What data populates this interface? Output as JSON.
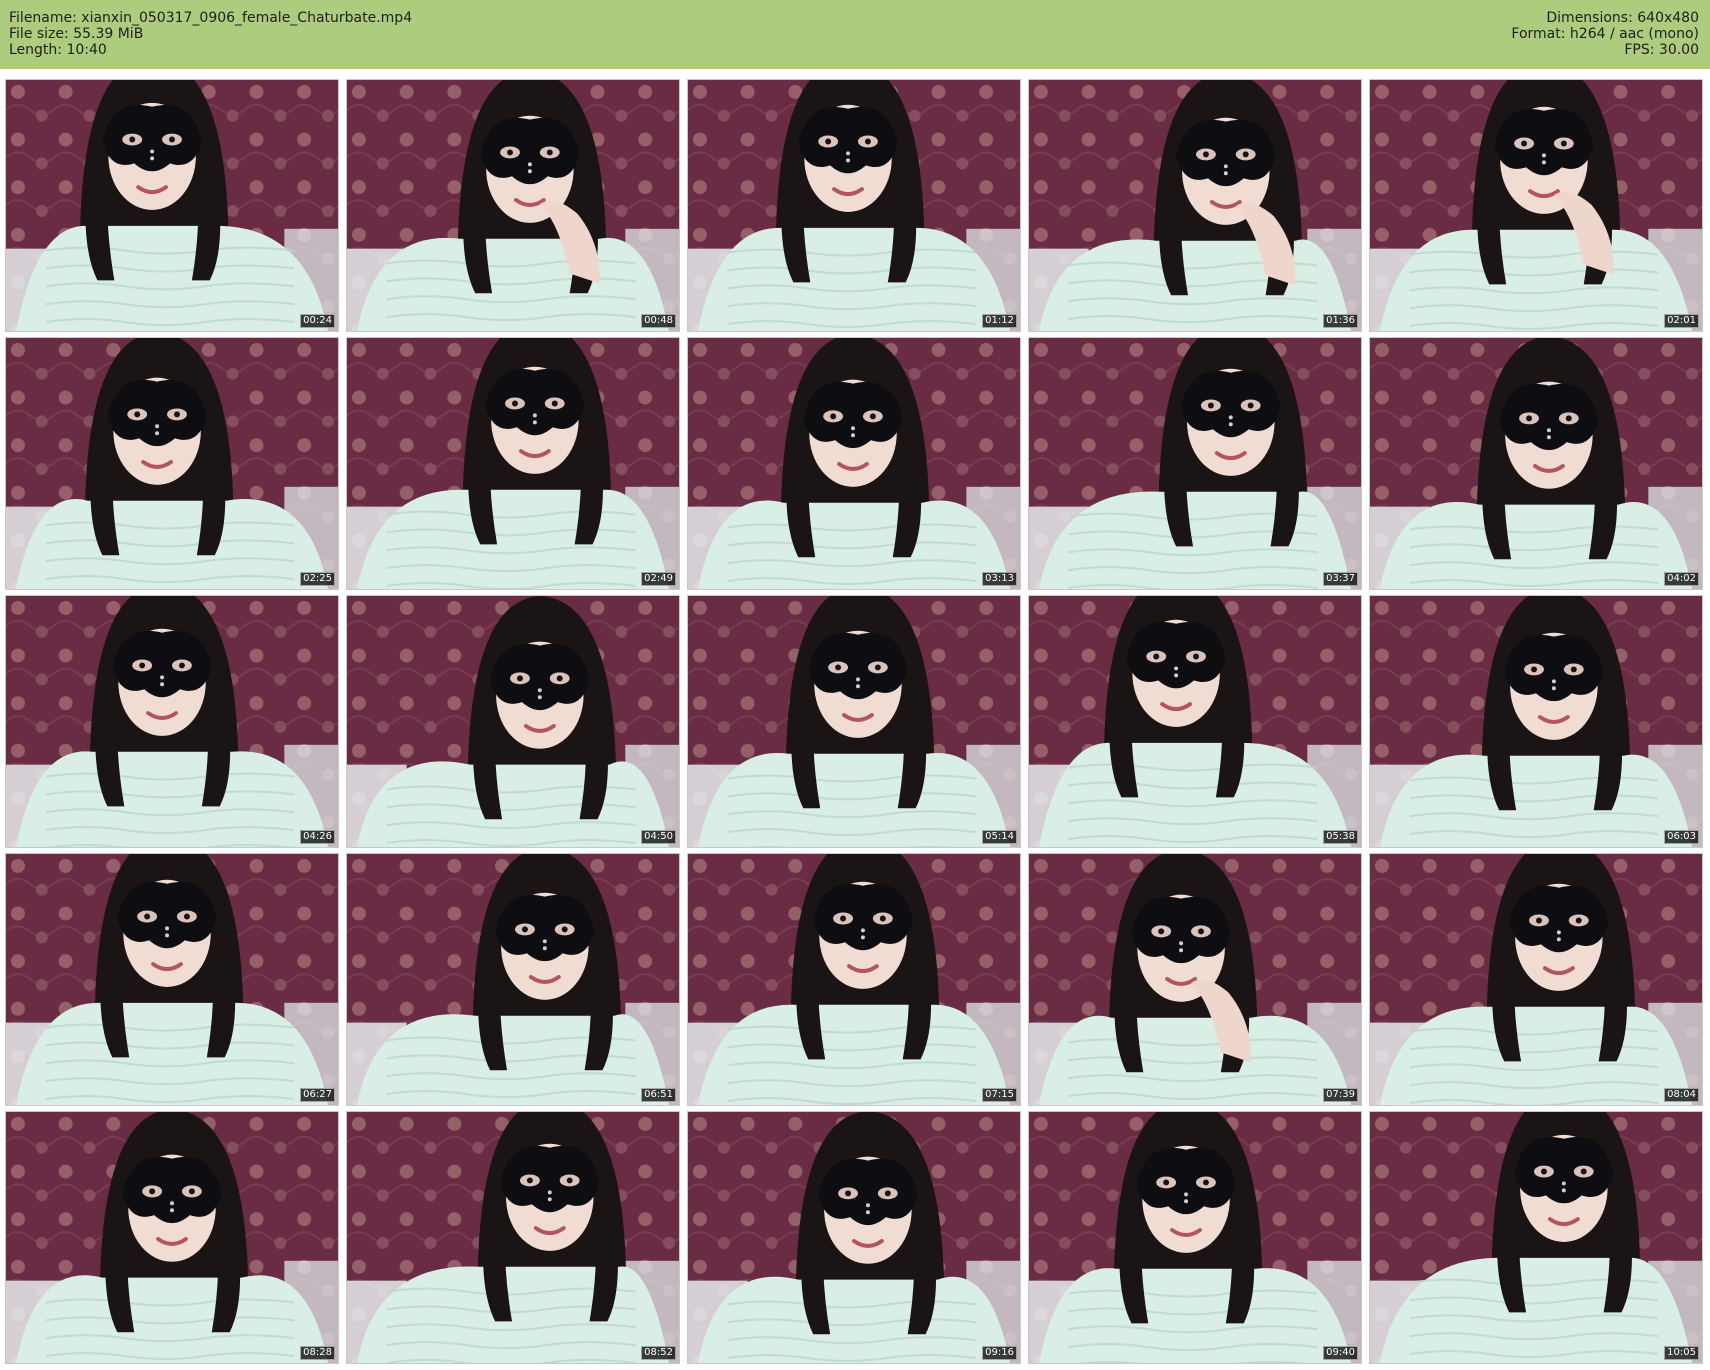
{
  "header": {
    "filename_line": "Filename: xianxin_050317_0906_female_Chaturbate.mp4",
    "filesize_line": "File size: 55.39 MiB",
    "length_line": "Length: 10:40",
    "dimensions_line": "Dimensions: 640x480",
    "format_line": "Format: h264 / aac (mono)",
    "fps_line": "FPS: 30.00",
    "background_color": "#aecc7d"
  },
  "thumbnails": [
    {
      "timestamp": "00:24"
    },
    {
      "timestamp": "00:48"
    },
    {
      "timestamp": "01:12"
    },
    {
      "timestamp": "01:36"
    },
    {
      "timestamp": "02:01"
    },
    {
      "timestamp": "02:25"
    },
    {
      "timestamp": "02:49"
    },
    {
      "timestamp": "03:13"
    },
    {
      "timestamp": "03:37"
    },
    {
      "timestamp": "04:02"
    },
    {
      "timestamp": "04:26"
    },
    {
      "timestamp": "04:50"
    },
    {
      "timestamp": "05:14"
    },
    {
      "timestamp": "05:38"
    },
    {
      "timestamp": "06:03"
    },
    {
      "timestamp": "06:27"
    },
    {
      "timestamp": "06:51"
    },
    {
      "timestamp": "07:15"
    },
    {
      "timestamp": "07:39"
    },
    {
      "timestamp": "08:04"
    },
    {
      "timestamp": "08:28"
    },
    {
      "timestamp": "08:52"
    },
    {
      "timestamp": "09:16"
    },
    {
      "timestamp": "09:40"
    },
    {
      "timestamp": "10:05"
    }
  ],
  "colors": {
    "wallpaper": "#6a2c44",
    "sweater": "#d9eee4",
    "hair": "#1b1414",
    "mask": "#0d0d12"
  }
}
